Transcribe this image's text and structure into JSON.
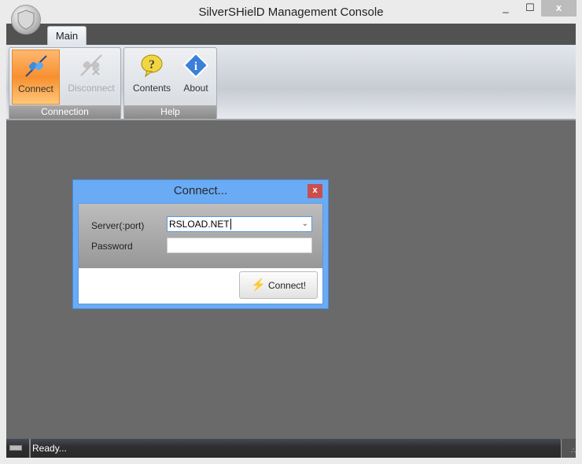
{
  "window": {
    "title": "SilverSHielD Management Console",
    "minimize": "_",
    "maximize": "☐",
    "close": "x"
  },
  "ribbon": {
    "tabs": [
      {
        "label": "Main"
      }
    ],
    "groups": [
      {
        "label": "Connection",
        "buttons": [
          {
            "label": "Connect",
            "icon": "plug-connect-icon",
            "active": true
          },
          {
            "label": "Disconnect",
            "icon": "plug-disconnect-icon",
            "enabled": false
          }
        ]
      },
      {
        "label": "Help",
        "buttons": [
          {
            "label": "Contents",
            "icon": "question-bubble-icon"
          },
          {
            "label": "About",
            "icon": "info-diamond-icon"
          }
        ]
      }
    ]
  },
  "dialog": {
    "title": "Connect...",
    "close": "x",
    "server_label": "Server(:port)",
    "server_value": "RSLOAD.NET",
    "password_label": "Password",
    "password_value": "",
    "connect_button": "Connect!"
  },
  "status": {
    "text": "Ready..."
  },
  "colors": {
    "dialog_frame": "#6aabf5",
    "active_button": "#f7a24a",
    "close_red": "#c94f4f"
  }
}
